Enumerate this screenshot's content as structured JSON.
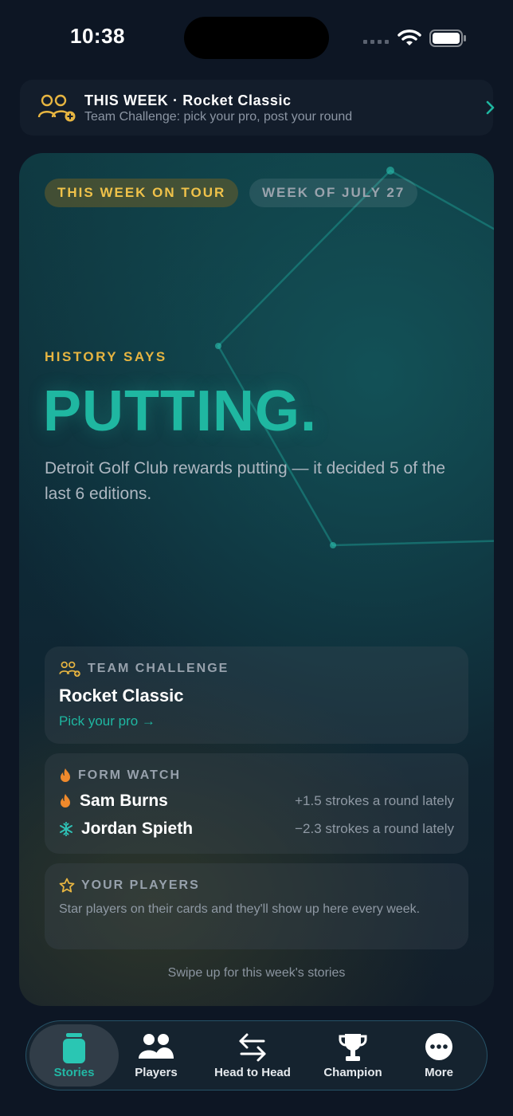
{
  "status_bar": {
    "time": "10:38"
  },
  "banner": {
    "title": "THIS WEEK · Rocket Classic",
    "subtitle": "Team Challenge: pick your pro, post your round",
    "icon": "team-add-icon"
  },
  "hero": {
    "pill_primary": "THIS WEEK ON TOUR",
    "pill_secondary": "WEEK OF JULY 27",
    "kicker": "HISTORY SAYS",
    "headline": "PUTTING.",
    "description": "Detroit Golf Club rewards putting — it decided 5 of the last 6 editions.",
    "team_challenge": {
      "label": "TEAM CHALLENGE",
      "title": "Rocket Classic",
      "link": "Pick your pro →"
    },
    "form_watch": {
      "label": "FORM WATCH",
      "players": [
        {
          "name": "Sam Burns",
          "stat": "+1.5 strokes a round lately",
          "icon": "fire-icon"
        },
        {
          "name": "Jordan Spieth",
          "stat": "−2.3 strokes a round lately",
          "icon": "snowflake-icon"
        }
      ]
    },
    "your_players": {
      "label": "YOUR PLAYERS",
      "text": "Star players on their cards and they'll show up here every week."
    },
    "swipe_hint": "Swipe up for this week's stories"
  },
  "tabs": [
    {
      "label": "Stories",
      "icon": "stories-icon",
      "active": true
    },
    {
      "label": "Players",
      "icon": "players-icon",
      "active": false
    },
    {
      "label": "Head to Head",
      "icon": "swap-arrows-icon",
      "active": false
    },
    {
      "label": "Champion",
      "icon": "trophy-icon",
      "active": false
    },
    {
      "label": "More",
      "icon": "more-icon",
      "active": false
    }
  ],
  "colors": {
    "background": "#0d1624",
    "accent_teal": "#1fb7a1",
    "accent_gold": "#e7b541",
    "text_muted": "#8f99a4"
  }
}
